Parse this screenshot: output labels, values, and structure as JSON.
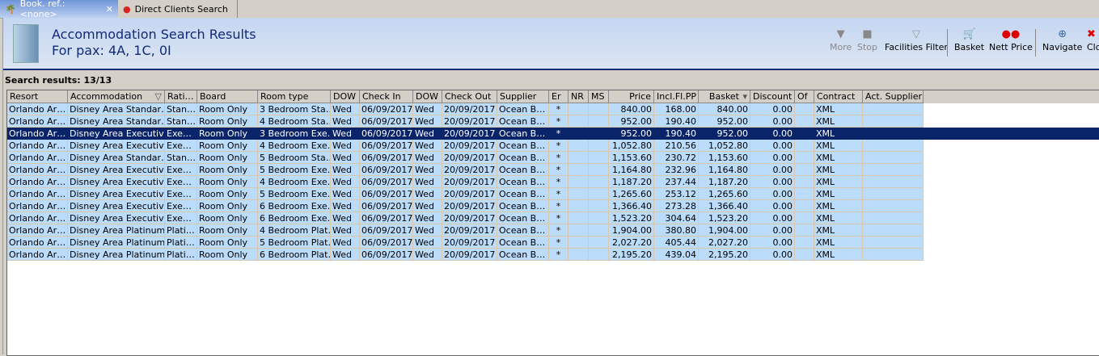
{
  "tabs": [
    {
      "label": "Book. ref.: <none>",
      "icon": "palm-island-icon"
    },
    {
      "label": "Direct Clients Search",
      "icon": "clients-icon"
    }
  ],
  "header": {
    "title": "Accommodation Search Results",
    "subtitle": "For pax: 4A, 1C, 0I"
  },
  "toolbar": [
    {
      "label": "More",
      "icon": "triangle-down-icon",
      "disabled": true
    },
    {
      "label": "Stop",
      "icon": "stop-icon",
      "disabled": true
    },
    {
      "label": "Facilities Filter",
      "icon": "funnel-icon"
    },
    {
      "label": "Basket",
      "icon": "cart-icon"
    },
    {
      "label": "Nett Price",
      "icon": "berries-icon"
    },
    {
      "label": "Navigate",
      "icon": "compass-icon"
    },
    {
      "label": "Close",
      "icon": "close-icon"
    }
  ],
  "search_results": "Search results: 13/13",
  "columns": [
    "Resort",
    "Accommodation",
    "Rati…",
    "Board",
    "Room type",
    "DOW",
    "Check In",
    "DOW",
    "Check Out",
    "Supplier",
    "Er",
    "NR",
    "MS",
    "Price",
    "Incl.Fl.PP",
    "Basket",
    "Discount",
    "Of",
    "Contract",
    "Act. Supplier"
  ],
  "selected_row": 2,
  "rows": [
    [
      "Orlando Ar…",
      "Disney Area Standar…",
      "Stan…",
      "Room Only",
      "3 Bedroom Sta…",
      "Wed",
      "06/09/2017",
      "Wed",
      "20/09/2017",
      "Ocean B…",
      "*",
      "",
      "",
      "840.00",
      "168.00",
      "840.00",
      "0.00",
      "",
      "XML",
      ""
    ],
    [
      "Orlando Ar…",
      "Disney Area Standar…",
      "Stan…",
      "Room Only",
      "4 Bedroom Sta…",
      "Wed",
      "06/09/2017",
      "Wed",
      "20/09/2017",
      "Ocean B…",
      "*",
      "",
      "",
      "952.00",
      "190.40",
      "952.00",
      "0.00",
      "",
      "XML",
      ""
    ],
    [
      "Orlando Ar…",
      "Disney Area Executiv…",
      "Exe…",
      "Room Only",
      "3 Bedroom Exe…",
      "Wed",
      "06/09/2017",
      "Wed",
      "20/09/2017",
      "Ocean B…",
      "*",
      "",
      "",
      "952.00",
      "190.40",
      "952.00",
      "0.00",
      "",
      "XML",
      ""
    ],
    [
      "Orlando Ar…",
      "Disney Area Executiv…",
      "Exe…",
      "Room Only",
      "4 Bedroom Exe…",
      "Wed",
      "06/09/2017",
      "Wed",
      "20/09/2017",
      "Ocean B…",
      "*",
      "",
      "",
      "1,052.80",
      "210.56",
      "1,052.80",
      "0.00",
      "",
      "XML",
      ""
    ],
    [
      "Orlando Ar…",
      "Disney Area Standar…",
      "Stan…",
      "Room Only",
      "5 Bedroom Sta…",
      "Wed",
      "06/09/2017",
      "Wed",
      "20/09/2017",
      "Ocean B…",
      "*",
      "",
      "",
      "1,153.60",
      "230.72",
      "1,153.60",
      "0.00",
      "",
      "XML",
      ""
    ],
    [
      "Orlando Ar…",
      "Disney Area Executiv…",
      "Exe…",
      "Room Only",
      "5 Bedroom Exe…",
      "Wed",
      "06/09/2017",
      "Wed",
      "20/09/2017",
      "Ocean B…",
      "*",
      "",
      "",
      "1,164.80",
      "232.96",
      "1,164.80",
      "0.00",
      "",
      "XML",
      ""
    ],
    [
      "Orlando Ar…",
      "Disney Area Executiv…",
      "Exe…",
      "Room Only",
      "4 Bedroom Exe…",
      "Wed",
      "06/09/2017",
      "Wed",
      "20/09/2017",
      "Ocean B…",
      "*",
      "",
      "",
      "1,187.20",
      "237.44",
      "1,187.20",
      "0.00",
      "",
      "XML",
      ""
    ],
    [
      "Orlando Ar…",
      "Disney Area Executiv…",
      "Exe…",
      "Room Only",
      "5 Bedroom Exe…",
      "Wed",
      "06/09/2017",
      "Wed",
      "20/09/2017",
      "Ocean B…",
      "*",
      "",
      "",
      "1,265.60",
      "253.12",
      "1,265.60",
      "0.00",
      "",
      "XML",
      ""
    ],
    [
      "Orlando Ar…",
      "Disney Area Executiv…",
      "Exe…",
      "Room Only",
      "6 Bedroom Exe…",
      "Wed",
      "06/09/2017",
      "Wed",
      "20/09/2017",
      "Ocean B…",
      "*",
      "",
      "",
      "1,366.40",
      "273.28",
      "1,366.40",
      "0.00",
      "",
      "XML",
      ""
    ],
    [
      "Orlando Ar…",
      "Disney Area Executiv…",
      "Exe…",
      "Room Only",
      "6 Bedroom Exe…",
      "Wed",
      "06/09/2017",
      "Wed",
      "20/09/2017",
      "Ocean B…",
      "*",
      "",
      "",
      "1,523.20",
      "304.64",
      "1,523.20",
      "0.00",
      "",
      "XML",
      ""
    ],
    [
      "Orlando Ar…",
      "Disney Area Platinum…",
      "Plati…",
      "Room Only",
      "4 Bedroom Plat…",
      "Wed",
      "06/09/2017",
      "Wed",
      "20/09/2017",
      "Ocean B…",
      "*",
      "",
      "",
      "1,904.00",
      "380.80",
      "1,904.00",
      "0.00",
      "",
      "XML",
      ""
    ],
    [
      "Orlando Ar…",
      "Disney Area Platinum…",
      "Plati…",
      "Room Only",
      "5 Bedroom Plat…",
      "Wed",
      "06/09/2017",
      "Wed",
      "20/09/2017",
      "Ocean B…",
      "*",
      "",
      "",
      "2,027.20",
      "405.44",
      "2,027.20",
      "0.00",
      "",
      "XML",
      ""
    ],
    [
      "Orlando Ar…",
      "Disney Area Platinum…",
      "Plati…",
      "Room Only",
      "6 Bedroom Plat…",
      "Wed",
      "06/09/2017",
      "Wed",
      "20/09/2017",
      "Ocean B…",
      "*",
      "",
      "",
      "2,195.20",
      "439.04",
      "2,195.20",
      "0.00",
      "",
      "XML",
      ""
    ]
  ]
}
